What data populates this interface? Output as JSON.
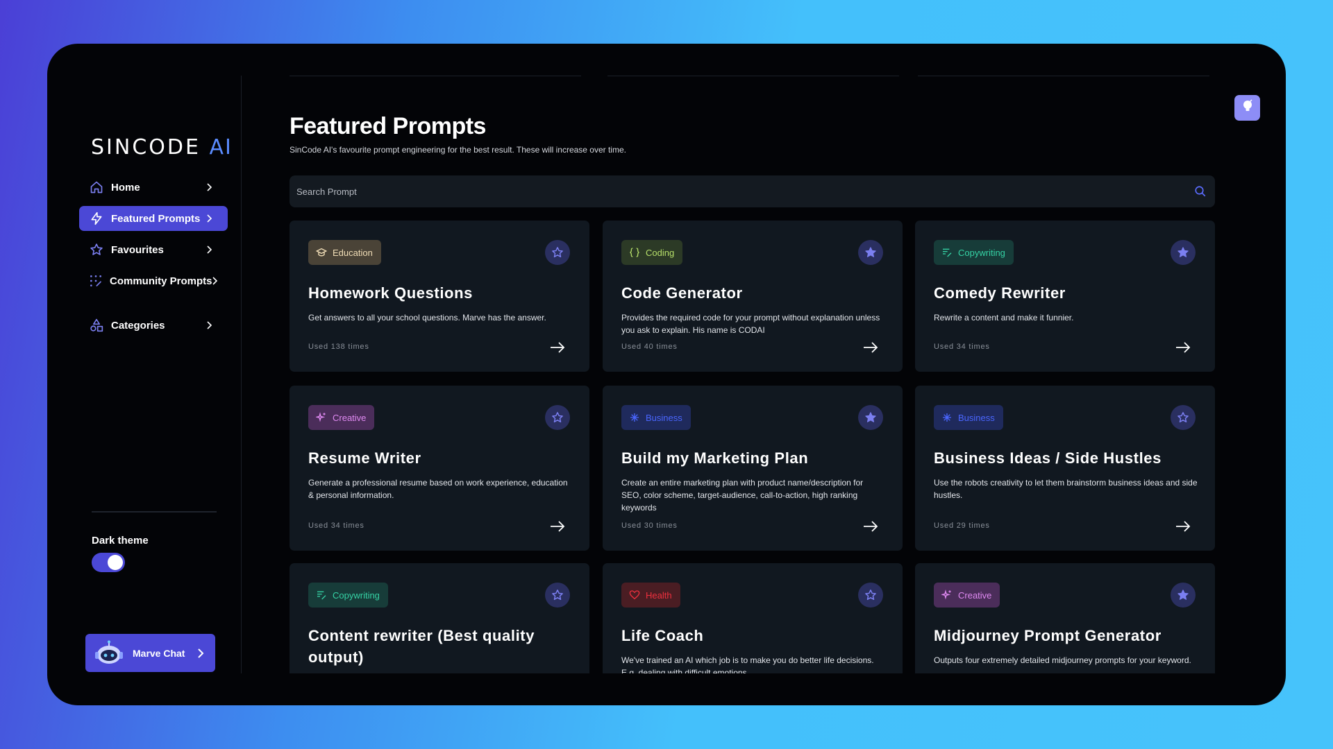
{
  "brand": {
    "name": "SINCODE",
    "accent": "AI",
    "accent_color": "#5b8cff"
  },
  "sidebar": {
    "items": [
      {
        "label": "Home",
        "icon": "home-icon"
      },
      {
        "label": "Featured Prompts",
        "icon": "lightning-icon",
        "active": true
      },
      {
        "label": "Favourites",
        "icon": "star-icon"
      },
      {
        "label": "Community Prompts",
        "icon": "community-icon"
      },
      {
        "label": "Categories",
        "icon": "shapes-icon"
      }
    ],
    "theme_label": "Dark theme",
    "theme_on": true,
    "chat_button": "Marve Chat"
  },
  "header": {
    "title": "Featured Prompts",
    "subtitle": "SinCode AI's favourite prompt engineering for the best result. These will increase over time."
  },
  "search": {
    "placeholder": "Search Prompt"
  },
  "colors": {
    "primary": "#4b48d6",
    "background": "#030407",
    "card": "#111820"
  },
  "cards": [
    {
      "tag": "Education",
      "tag_icon": "graduation-cap-icon",
      "title": "Homework Questions",
      "description": "Get answers to all your school questions. Marve has the answer.",
      "used": "Used 138 times",
      "favourited": false
    },
    {
      "tag": "Coding",
      "tag_icon": "code-braces-icon",
      "title": "Code Generator",
      "description": "Provides the required code for your prompt without explanation unless you ask to explain. His name is CODAI",
      "used": "Used 40 times",
      "favourited": true
    },
    {
      "tag": "Copywriting",
      "tag_icon": "text-edit-icon",
      "title": "Comedy Rewriter",
      "description": "Rewrite a content and make it funnier.",
      "used": "Used 34 times",
      "favourited": true
    },
    {
      "tag": "Creative",
      "tag_icon": "sparkle-icon",
      "title": "Resume Writer",
      "description": "Generate a professional resume based on work experience, education & personal information.",
      "used": "Used 34 times",
      "favourited": false
    },
    {
      "tag": "Business",
      "tag_icon": "business-icon",
      "title": "Build my Marketing Plan",
      "description": "Create an entire marketing plan with product name/description for SEO, color scheme, target-audience, call-to-action, high ranking keywords",
      "used": "Used 30 times",
      "favourited": true
    },
    {
      "tag": "Business",
      "tag_icon": "business-icon",
      "title": "Business Ideas / Side Hustles",
      "description": "Use the robots creativity to let them brainstorm business ideas and side hustles.",
      "used": "Used 29 times",
      "favourited": false
    },
    {
      "tag": "Copywriting",
      "tag_icon": "text-edit-icon",
      "title": "Content rewriter (Best quality output)",
      "description": "",
      "used": "",
      "favourited": false
    },
    {
      "tag": "Health",
      "tag_icon": "heart-icon",
      "title": "Life Coach",
      "description": "We've trained an AI which job is to make you do better life decisions. E.g. dealing with difficult emotions.",
      "used": "",
      "favourited": false
    },
    {
      "tag": "Creative",
      "tag_icon": "sparkle-icon",
      "title": "Midjourney Prompt Generator",
      "description": "Outputs four extremely detailed midjourney prompts for your keyword.",
      "used": "",
      "favourited": true
    }
  ],
  "tag_styles": {
    "Education": {
      "bg": "#4a4337",
      "fg": "#f2dfb8"
    },
    "Coding": {
      "bg": "#2c3a26",
      "fg": "#b7e06a"
    },
    "Copywriting": {
      "bg": "#173c39",
      "fg": "#35d3a5"
    },
    "Creative": {
      "bg": "#4b2d5a",
      "fg": "#e08af2"
    },
    "Business": {
      "bg": "#1f2a5c",
      "fg": "#4a66ff"
    },
    "Health": {
      "bg": "#4a1d23",
      "fg": "#f0303e"
    }
  }
}
